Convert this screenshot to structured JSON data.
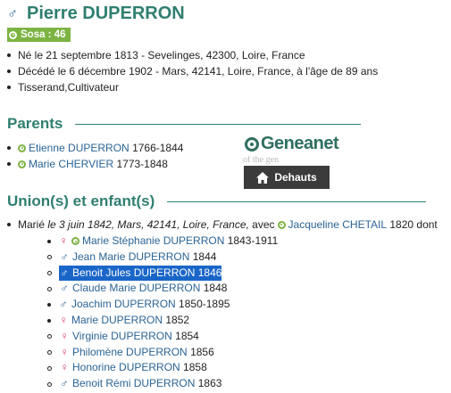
{
  "person": {
    "gender_symbol": "♂",
    "name": "Pierre DUPERRON",
    "sosa": "Sosa : 46",
    "facts": [
      "Né le 21 septembre 1813 - Sevelinges, 42300, Loire, France",
      "Décédé le 6 décembre 1902 - Mars, 42141, Loire, France, à l'âge de 89 ans",
      "Tisserand,Cultivateur"
    ]
  },
  "parents": {
    "title": "Parents",
    "list": [
      {
        "name": "Etienne DUPERRON",
        "dates": "1766-1844"
      },
      {
        "name": "Marie CHERVIER",
        "dates": "1773-1848"
      }
    ]
  },
  "ad": {
    "logo_text": "Geneanet",
    "ghost_text": "of the gen",
    "button_label": "Dehauts"
  },
  "unions": {
    "title": "Union(s) et enfant(s)",
    "prefix": "Marié",
    "detail": "le 3 juin 1842, Mars, 42141, Loire, France,",
    "avec": "avec",
    "spouse": "Jacqueline CHETAIL",
    "spouse_dates": "1820 dont",
    "children": [
      {
        "sex": "f",
        "sosa": true,
        "name": "Marie Stéphanie DUPERRON",
        "dates": "1843-1911",
        "bullet": "filled"
      },
      {
        "sex": "m",
        "sosa": false,
        "name": "Jean Marie DUPERRON",
        "dates": "1844",
        "bullet": "hollow"
      },
      {
        "sex": "m",
        "sosa": false,
        "name": "Benoit Jules DUPERRON",
        "dates": "1846",
        "bullet": "hollow",
        "selected": true
      },
      {
        "sex": "m",
        "sosa": false,
        "name": "Claude Marie DUPERRON",
        "dates": "1848",
        "bullet": "hollow"
      },
      {
        "sex": "m",
        "sosa": false,
        "name": "Joachim DUPERRON",
        "dates": "1850-1895",
        "bullet": "filled"
      },
      {
        "sex": "f",
        "sosa": false,
        "name": "Marie DUPERRON",
        "dates": "1852",
        "bullet": "filled"
      },
      {
        "sex": "f",
        "sosa": false,
        "name": "Virginie DUPERRON",
        "dates": "1854",
        "bullet": "hollow"
      },
      {
        "sex": "f",
        "sosa": false,
        "name": "Philomène DUPERRON",
        "dates": "1856",
        "bullet": "hollow"
      },
      {
        "sex": "f",
        "sosa": false,
        "name": "Honorine DUPERRON",
        "dates": "1858",
        "bullet": "hollow"
      },
      {
        "sex": "m",
        "sosa": false,
        "name": "Benoit Rémi DUPERRON",
        "dates": "1863",
        "bullet": "hollow"
      }
    ]
  },
  "symbols": {
    "male": "♂",
    "female": "♀"
  },
  "colors": {
    "heading": "#2f7f6f",
    "link": "#2a6496",
    "sosa_badge": "#7cb342",
    "female": "#d63384",
    "selection": "#1a66c8"
  }
}
